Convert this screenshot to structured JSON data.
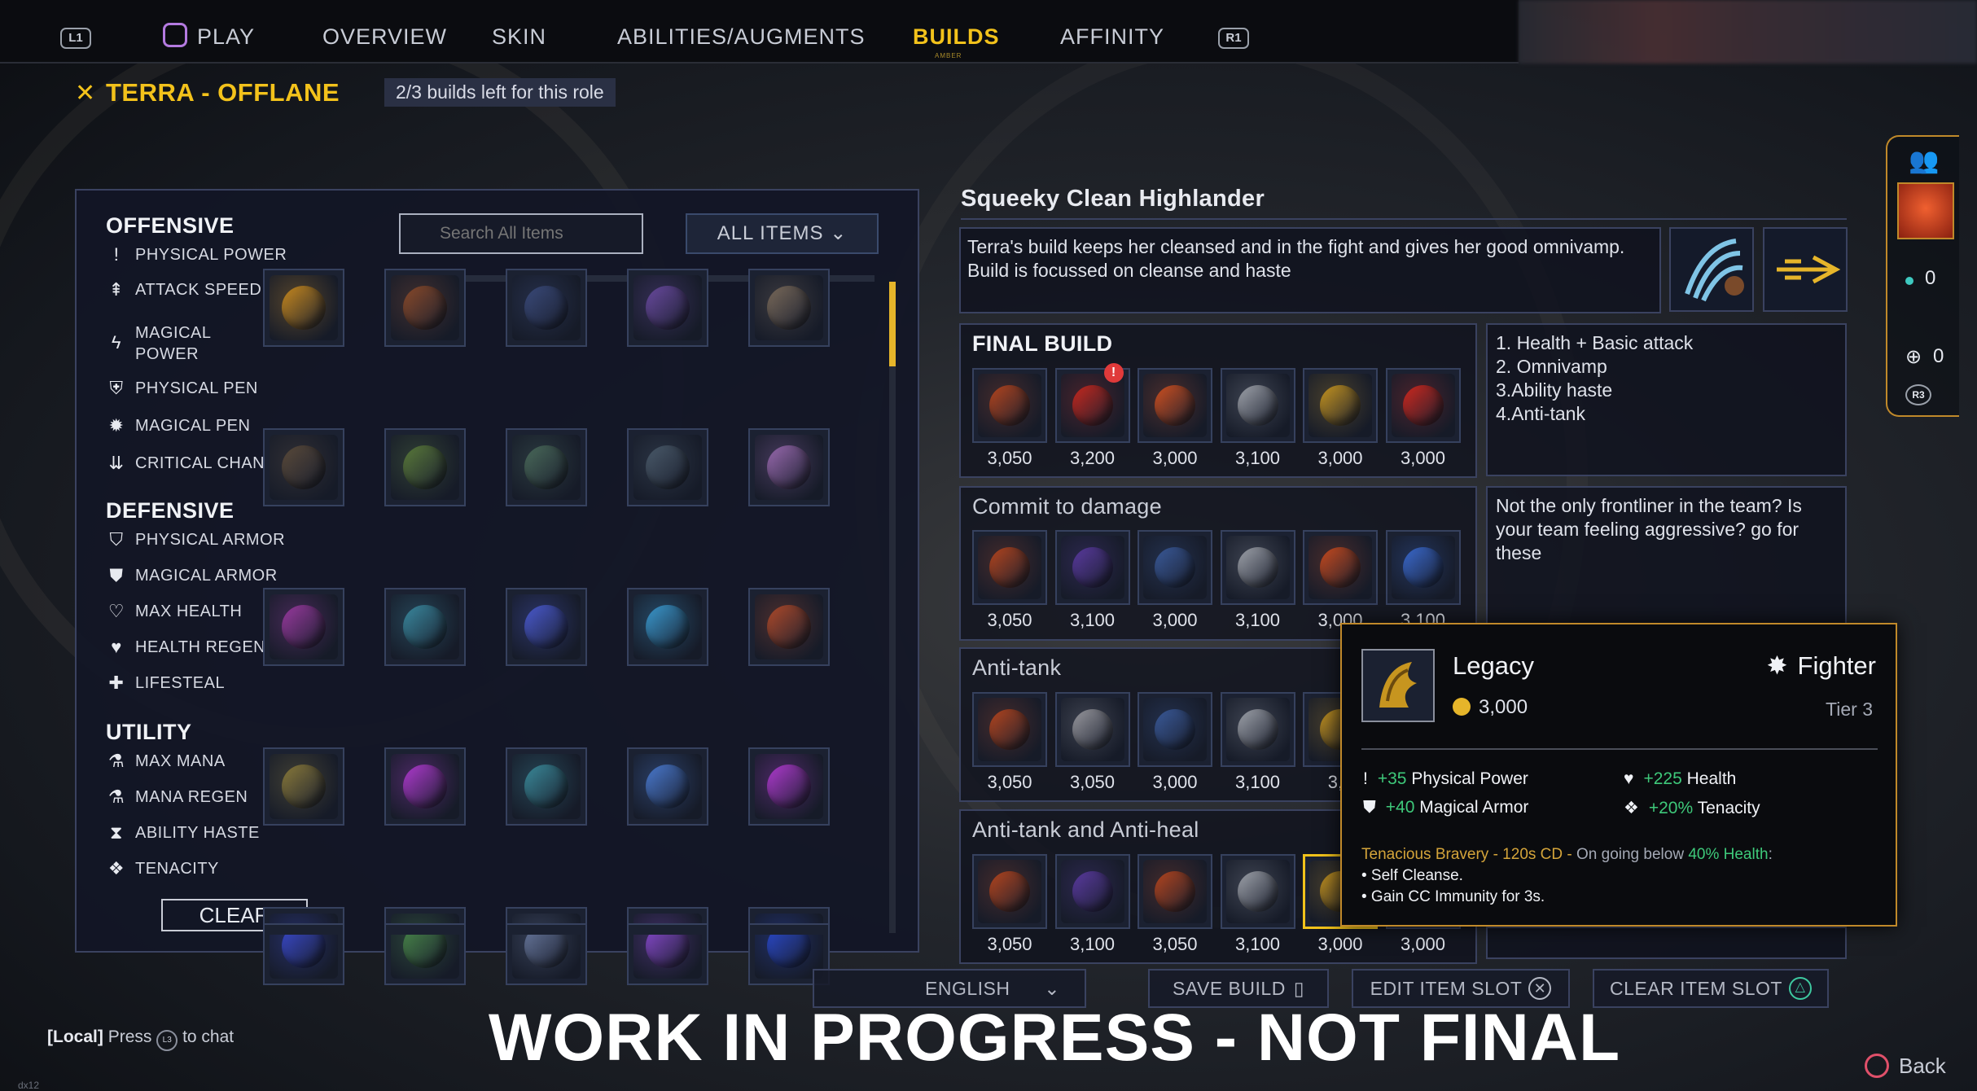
{
  "nav": {
    "l1": "L1",
    "r1": "R1",
    "tabs": [
      {
        "label": "PLAY"
      },
      {
        "label": "OVERVIEW"
      },
      {
        "label": "SKIN"
      },
      {
        "label": "ABILITIES/AUGMENTS"
      },
      {
        "label": "BUILDS"
      },
      {
        "label": "AFFINITY"
      }
    ],
    "active_tab": "BUILDS",
    "builds_sub": "AMBER"
  },
  "role": {
    "title": "TERRA - OFFLANE",
    "builds_left": "2/3 builds left for this role"
  },
  "filters": {
    "offensive": {
      "heading": "OFFENSIVE",
      "items": [
        "PHYSICAL POWER",
        "ATTACK SPEED",
        "MAGICAL",
        "POWER",
        "PHYSICAL PEN",
        "MAGICAL PEN",
        "CRITICAL CHANCE"
      ]
    },
    "defensive": {
      "heading": "DEFENSIVE",
      "items": [
        "PHYSICAL ARMOR",
        "MAGICAL ARMOR",
        "MAX HEALTH",
        "HEALTH REGEN",
        "LIFESTEAL"
      ]
    },
    "utility": {
      "heading": "UTILITY",
      "items": [
        "MAX MANA",
        "MANA REGEN",
        "ABILITY HASTE",
        "TENACITY"
      ]
    },
    "clear_label": "CLEAR"
  },
  "search": {
    "placeholder": "Search All Items"
  },
  "dropdown": {
    "label": "ALL ITEMS"
  },
  "item_icons": [
    [
      "ring-icon",
      "bow-icon",
      "scimitar-icon",
      "dagger-icon",
      "crossbow-icon"
    ],
    [
      "chestplate-icon",
      "claw-icon",
      "boots-icon",
      "gauntlet-icon",
      "coral-icon"
    ],
    [
      "staff-icon",
      "wand-icon",
      "armor-icon",
      "boot-icon",
      "torch-icon"
    ],
    [
      "bowl-icon",
      "blade-icon",
      "crown-icon",
      "trident-icon",
      "eye-icon"
    ],
    [
      "longbow-icon",
      "amulet-icon",
      "tiara-icon",
      "pendant-icon",
      "axe-icon"
    ]
  ],
  "build": {
    "name": "Squeeky Clean Highlander",
    "description": [
      "Terra's build keeps her cleansed and in the fight and gives her good omnivamp.",
      "Build is focussed on cleanse and haste"
    ]
  },
  "sections": [
    {
      "title": "FINAL BUILD",
      "prices": [
        "3,050",
        "3,200",
        "3,000",
        "3,100",
        "3,000",
        "3,000"
      ]
    },
    {
      "title": "Commit to damage",
      "prices": [
        "3,050",
        "3,100",
        "3,000",
        "3,100",
        "3,000",
        "3,100"
      ]
    },
    {
      "title": "Anti-tank",
      "prices": [
        "3,050",
        "3,050",
        "3,000",
        "3,100",
        "3,0"
      ]
    },
    {
      "title": "Anti-tank and Anti-heal",
      "prices": [
        "3,050",
        "3,100",
        "3,050",
        "3,100",
        "3,000",
        "3,000"
      ]
    }
  ],
  "notes": {
    "final": [
      "1. Health + Basic attack",
      "2. Omnivamp",
      "3.Ability haste",
      "4.Anti-tank"
    ],
    "commit": [
      "Not the only frontliner in the team? Is",
      "your team feeling aggressive? go for",
      "these"
    ]
  },
  "tooltip": {
    "name": "Legacy",
    "class": "Fighter",
    "cost": "3,000",
    "tier": "Tier 3",
    "stats": [
      {
        "value": "+35",
        "label": "Physical Power"
      },
      {
        "value": "+225",
        "label": "Health"
      },
      {
        "value": "+40",
        "label": "Magical Armor"
      },
      {
        "value": "+20%",
        "label": "Tenacity"
      }
    ],
    "passive_title": "Tenacious Bravery - 120s CD -",
    "passive_cond": "On going below",
    "passive_hl": "40% Health",
    "passive_lines": [
      "• Self Cleanse.",
      "• Gain CC Immunity for 3s."
    ]
  },
  "bottom": {
    "language": "ENGLISH",
    "save": "SAVE BUILD",
    "edit": "EDIT ITEM SLOT",
    "clear_slot": "CLEAR ITEM SLOT",
    "watermark": "WORK IN PROGRESS - NOT FINAL",
    "chat_local": "[Local]",
    "chat_press": "Press",
    "chat_l3": "L3",
    "chat_to": "to chat",
    "back": "Back",
    "version": "dx12"
  },
  "side": {
    "count1": "0",
    "count2": "0",
    "r3": "R3"
  },
  "colors": {
    "accent": "#f3c21b",
    "panel": "#121626",
    "border": "#3a4260",
    "positive": "#3ec97a",
    "tooltip_border": "#c0892a"
  }
}
